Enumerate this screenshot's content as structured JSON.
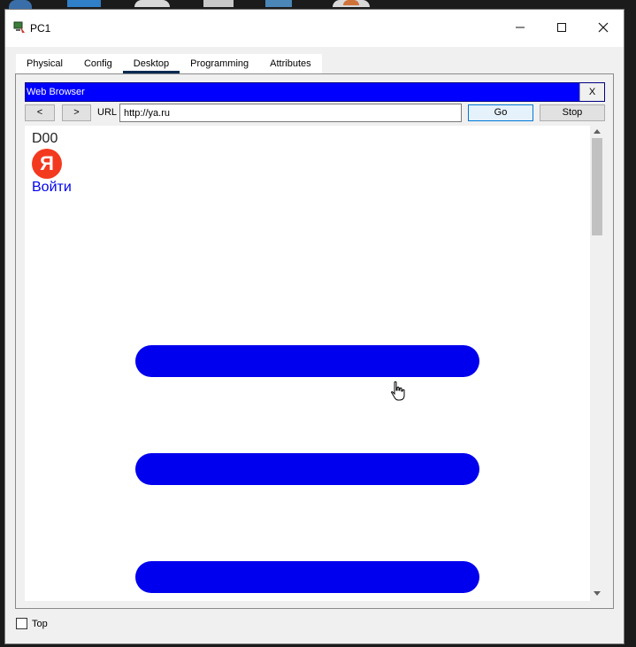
{
  "window": {
    "title": "PC1",
    "controls": {
      "minimize": "—",
      "maximize": "☐",
      "close": "✕"
    }
  },
  "tabs": [
    {
      "label": "Physical",
      "active": false
    },
    {
      "label": "Config",
      "active": false
    },
    {
      "label": "Desktop",
      "active": true
    },
    {
      "label": "Programming",
      "active": false
    },
    {
      "label": "Attributes",
      "active": false
    }
  ],
  "browser": {
    "title": "Web Browser",
    "close_label": "X",
    "back_label": "<",
    "forward_label": ">",
    "url_label": "URL",
    "url_value": "http://ya.ru",
    "go_label": "Go",
    "stop_label": "Stop",
    "title_color": "#0000ff"
  },
  "page": {
    "heading": "D00",
    "logo_letter": "Я",
    "login_link": "Войти",
    "bar_color": "#0000ee"
  },
  "footer": {
    "top_checkbox_label": "Top",
    "top_checked": false
  }
}
